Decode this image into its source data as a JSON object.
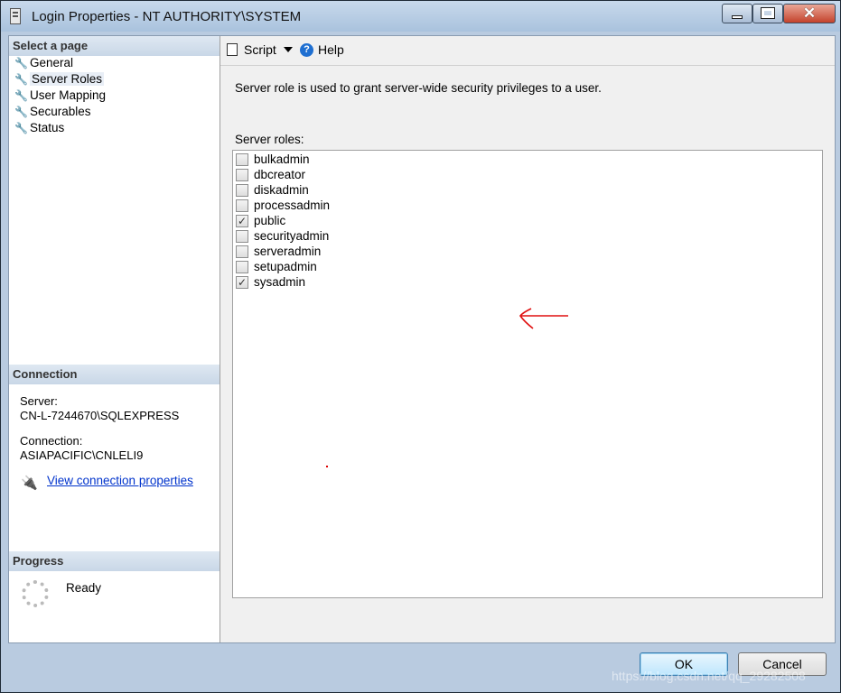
{
  "window": {
    "title": "Login Properties - NT AUTHORITY\\SYSTEM",
    "minimize": "",
    "maximize": "",
    "close": "✕"
  },
  "left_pane": {
    "select_page_header": "Select a page",
    "pages": [
      {
        "label": "General"
      },
      {
        "label": "Server Roles"
      },
      {
        "label": "User Mapping"
      },
      {
        "label": "Securables"
      },
      {
        "label": "Status"
      }
    ],
    "selected_page": "Server Roles",
    "connection": {
      "header": "Connection",
      "server_label": "Server:",
      "server_value": "CN-L-7244670\\SQLEXPRESS",
      "connection_label": "Connection:",
      "connection_value": "ASIAPACIFIC\\CNLELI9",
      "view_link": "View connection properties"
    },
    "progress": {
      "header": "Progress",
      "status": "Ready"
    }
  },
  "toolbar": {
    "script_label": "Script",
    "help_label": "Help"
  },
  "main": {
    "description": "Server role is used to grant server-wide security privileges to a user.",
    "roles_label": "Server roles:",
    "roles": [
      {
        "name": "bulkadmin",
        "checked": false
      },
      {
        "name": "dbcreator",
        "checked": false
      },
      {
        "name": "diskadmin",
        "checked": false
      },
      {
        "name": "processadmin",
        "checked": false
      },
      {
        "name": "public",
        "checked": true
      },
      {
        "name": "securityadmin",
        "checked": false
      },
      {
        "name": "serveradmin",
        "checked": false
      },
      {
        "name": "setupadmin",
        "checked": false
      },
      {
        "name": "sysadmin",
        "checked": true
      }
    ]
  },
  "buttons": {
    "ok": "OK",
    "cancel": "Cancel"
  },
  "watermark": "https://blog.csdn.net/qq_29282508",
  "colors": {
    "link": "#0033cc",
    "annotation": "#e01010",
    "header_bg": "#c9d7e7"
  }
}
